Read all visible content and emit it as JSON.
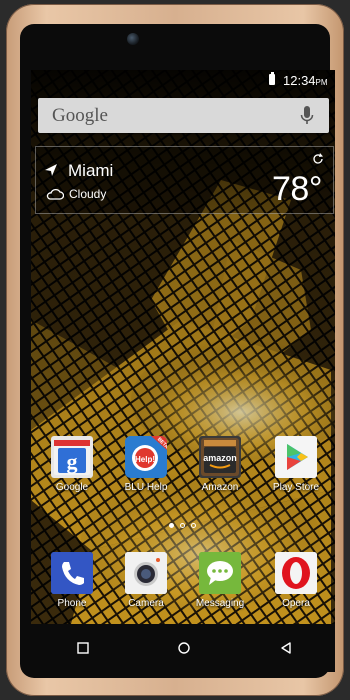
{
  "status_bar": {
    "time": "12:34",
    "ampm": "PM"
  },
  "search": {
    "logo": "Google"
  },
  "weather": {
    "city": "Miami",
    "condition": "Cloudy",
    "temperature": "78°"
  },
  "apps": [
    {
      "label": "Google",
      "icon": "google-search-icon"
    },
    {
      "label": "BLU Help",
      "icon": "blu-help-icon",
      "badge": "BETA",
      "icon_text": "Help!"
    },
    {
      "label": "Amazon",
      "icon": "amazon-icon",
      "icon_text": "amazon"
    },
    {
      "label": "Play Store",
      "icon": "play-store-icon"
    }
  ],
  "dock": [
    {
      "label": "Phone",
      "icon": "phone-icon"
    },
    {
      "label": "Camera",
      "icon": "camera-icon"
    },
    {
      "label": "Messaging",
      "icon": "messaging-icon"
    },
    {
      "label": "Opera",
      "icon": "opera-icon"
    }
  ],
  "page_indicator": {
    "pages": 3,
    "current": 1
  },
  "navigation": [
    "recents-icon",
    "home-icon",
    "back-icon"
  ],
  "colors": {
    "phone_frame": "#d7b08f",
    "wallpaper_gold": "#c8961e",
    "search_bar": "#d9d9d9"
  }
}
